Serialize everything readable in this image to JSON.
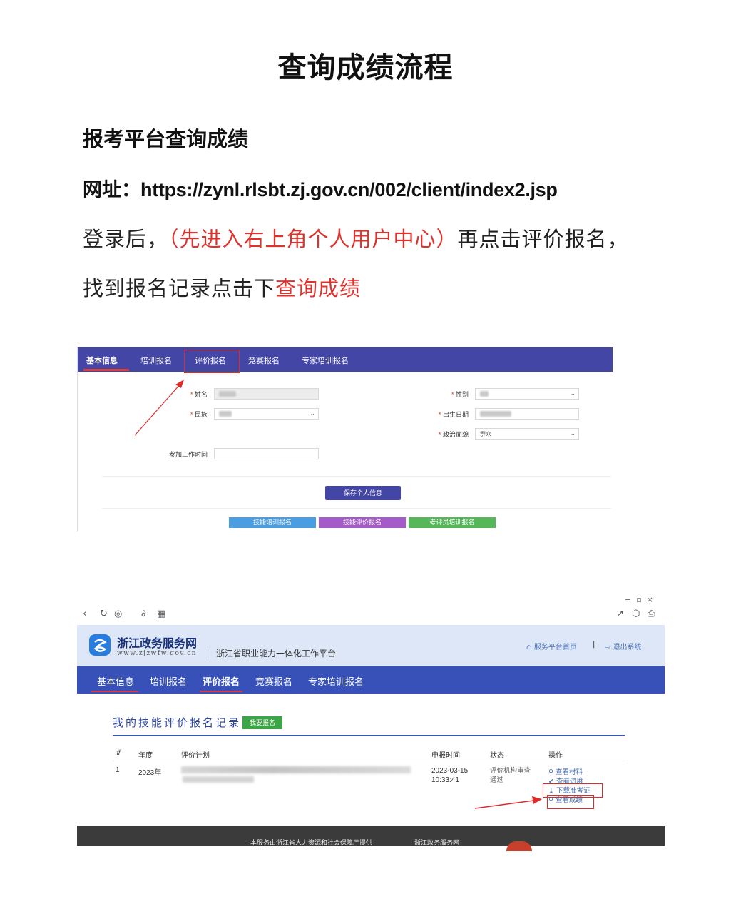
{
  "doc": {
    "title": "查询成绩流程",
    "subtitle": "报考平台查询成绩",
    "url_label": "网址：",
    "url": "https://zynl.rlsbt.zj.gov.cn/002/client/index2.jsp",
    "line1_a": "登录后，",
    "line1_red": "（先进入右上角个人用户中心）",
    "line1_b": "再点击评价报名，",
    "line2_a": "找到报名记录点击下",
    "line2_red": "查询成绩"
  },
  "shot1": {
    "nav": [
      "基本信息",
      "培训报名",
      "评价报名",
      "竞赛报名",
      "专家培训报名"
    ],
    "labels": {
      "name": "姓名",
      "gender": "性别",
      "ethnic": "民族",
      "birth": "出生日期",
      "political": "政治面貌",
      "work_time": "参加工作时间"
    },
    "political_value": "群众",
    "save_btn": "保存个人信息",
    "bottom_btns": [
      "技能培训报名",
      "技能评价报名",
      "考评员培训报名"
    ],
    "colors": {
      "nav": "#4446a6",
      "btn_blue": "#4a9de0",
      "btn_purple": "#a45cc8",
      "btn_green": "#55b65a"
    }
  },
  "shot2": {
    "brand_name": "浙江政务服务网",
    "brand_url": "www.zjzwfw.gov.cn",
    "platform": "浙江省职业能力一体化工作平台",
    "home_link": "服务平台首页",
    "logout_link": "退出系统",
    "nav": [
      "基本信息",
      "培训报名",
      "评价报名",
      "竞赛报名",
      "专家培训报名"
    ],
    "section_title": "我的技能评价报名记录",
    "apply_btn": "我要报名",
    "table_headers": [
      "#",
      "年度",
      "评价计划",
      "申报时间",
      "状态",
      "操作"
    ],
    "row": {
      "index": "1",
      "year": "2023年",
      "date": "2023-03-15",
      "time": "10:33:41",
      "status_1": "评价机构审查",
      "status_2": "通过"
    },
    "actions": [
      "查看材料",
      "查看进度",
      "下载准考证",
      "查看成绩"
    ],
    "footer_a": "本服务由浙江省人力资源和社会保障厅提供",
    "footer_b": "浙江政务服务网"
  }
}
